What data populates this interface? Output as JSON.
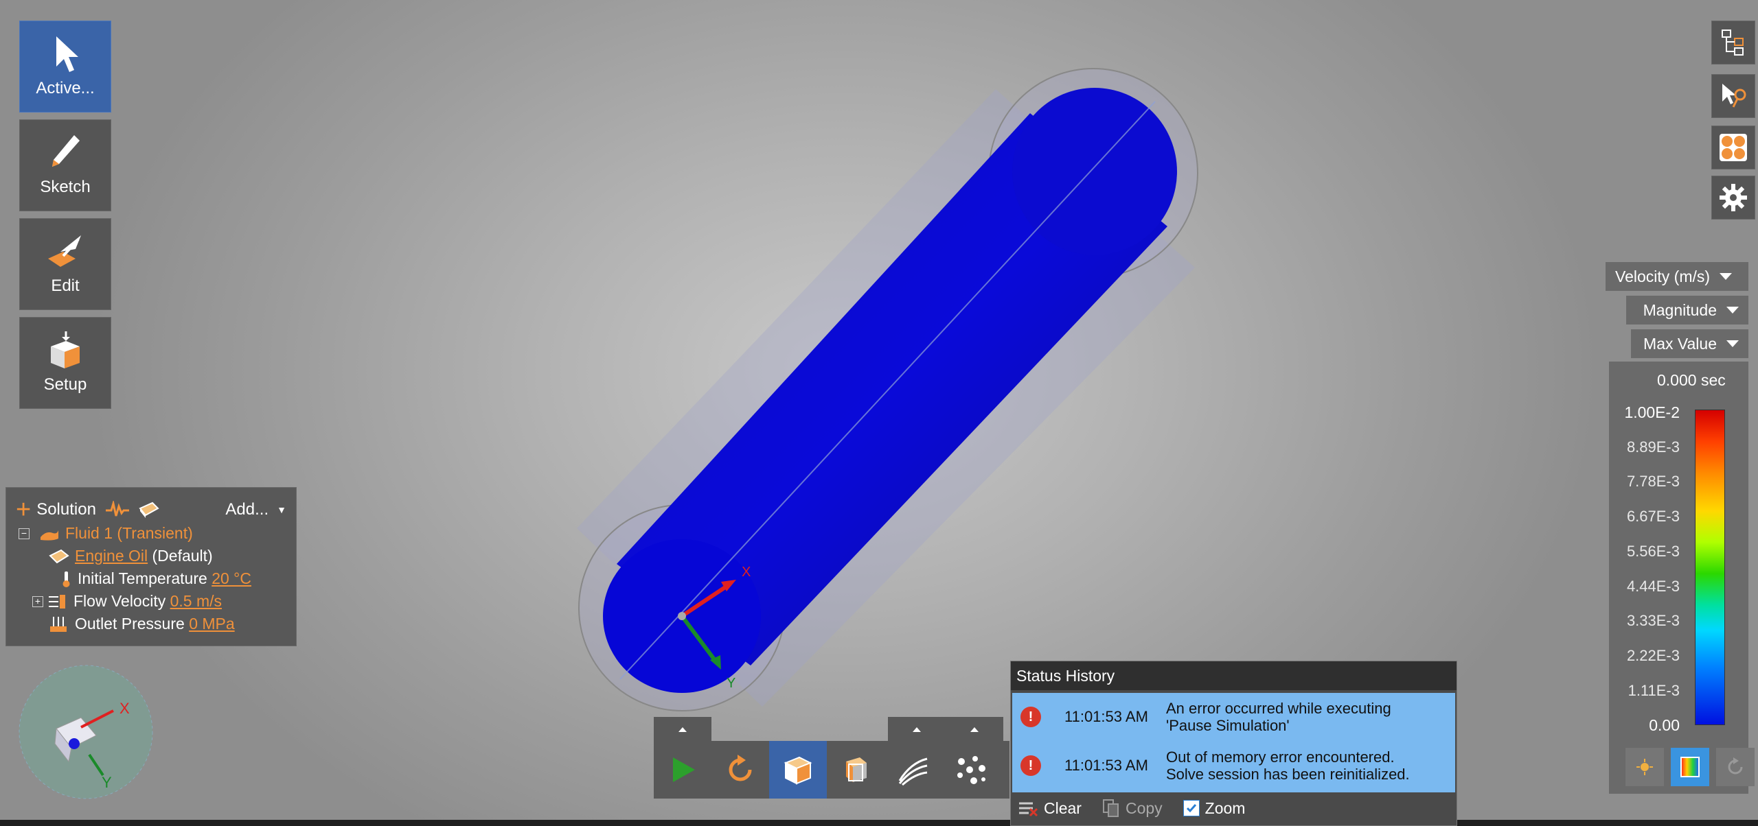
{
  "tools": [
    {
      "label": "Active...",
      "active": true,
      "icon": "cursor-arrow-icon"
    },
    {
      "label": "Sketch",
      "active": false,
      "icon": "pencil-icon"
    },
    {
      "label": "Edit",
      "active": false,
      "icon": "edit-pull-icon"
    },
    {
      "label": "Setup",
      "active": false,
      "icon": "setup-box-icon"
    }
  ],
  "tree": {
    "header": "Solution",
    "add_label": "Add...",
    "fluid": "Fluid 1 (Transient)",
    "material_link": "Engine Oil",
    "material_suffix": "(Default)",
    "initial_temperature_label": "Initial Temperature",
    "initial_temperature_value": "20 °C",
    "flow_velocity_label": "Flow Velocity",
    "flow_velocity_value": "0.5 m/s",
    "outlet_pressure_label": "Outlet Pressure",
    "outlet_pressure_value": "0 MPa"
  },
  "right_icons": [
    "structure-tree-icon",
    "select-pointer-icon",
    "display-quad-icon",
    "gear-icon"
  ],
  "legend": {
    "variable": "Velocity (m/s)",
    "component": "Magnitude",
    "range_mode": "Max Value",
    "time": "0.000 sec",
    "ticks": [
      "1.00E-2",
      "8.89E-3",
      "7.78E-3",
      "6.67E-3",
      "5.56E-3",
      "4.44E-3",
      "3.33E-3",
      "2.22E-3",
      "1.11E-3",
      "0.00"
    ]
  },
  "axes": {
    "x": "X",
    "y": "Y"
  },
  "status_history": {
    "title": "Status History",
    "entries": [
      {
        "time": "11:01:53 AM",
        "line1": "An error occurred while executing",
        "line2": "'Pause Simulation'"
      },
      {
        "time": "11:01:53 AM",
        "line1": "Out of memory error encountered.",
        "line2": "Solve session has been reinitialized."
      }
    ],
    "clear": "Clear",
    "copy": "Copy",
    "zoom": "Zoom"
  },
  "colors": {
    "accent_blue": "#3a64a8",
    "orange": "#f0913a",
    "pipe_blue": "#0a0ad8",
    "status_blue": "#7ab9f0"
  }
}
